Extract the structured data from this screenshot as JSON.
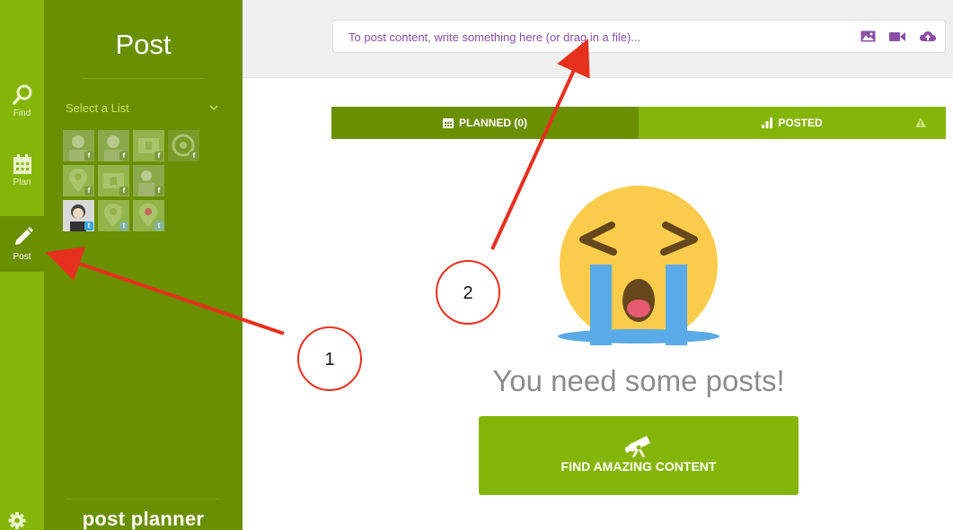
{
  "nav": {
    "items": [
      {
        "label": "Find",
        "icon": "search-icon"
      },
      {
        "label": "Plan",
        "icon": "calendar-icon"
      },
      {
        "label": "Post",
        "icon": "pencil-icon",
        "active": true
      }
    ],
    "settings_icon": "gear-icon"
  },
  "panel": {
    "title": "Post",
    "select_list_label": "Select a List",
    "profiles": [
      {
        "network": "facebook"
      },
      {
        "network": "facebook"
      },
      {
        "network": "facebook"
      },
      {
        "network": "facebook"
      },
      {
        "network": "facebook"
      },
      {
        "network": "facebook"
      },
      {
        "network": "facebook"
      },
      {
        "network": "twitter"
      },
      {
        "network": "twitter"
      },
      {
        "network": "twitter"
      }
    ],
    "logo_text": "post planner"
  },
  "composer": {
    "placeholder": "To post content, write something here (or drag in a file)...",
    "icons": [
      "image-icon",
      "video-icon",
      "upload-icon"
    ]
  },
  "tabs": [
    {
      "label": "PLANNED (0)",
      "icon": "calendar-icon",
      "active": true
    },
    {
      "label": "POSTED",
      "icon": "bar-chart-icon",
      "active": false,
      "badge_icon": "warning-icon"
    }
  ],
  "empty_state": {
    "icon": "crying-face-icon",
    "message": "You need some posts!",
    "button_label": "FIND AMAZING CONTENT",
    "button_icon": "telescope-icon"
  },
  "annotations": [
    {
      "number": "1"
    },
    {
      "number": "2"
    }
  ],
  "colors": {
    "rail": "#86b50a",
    "panel": "#6a8f00",
    "accent_purple": "#8a4fa5",
    "annotation_red": "#e6301e"
  }
}
